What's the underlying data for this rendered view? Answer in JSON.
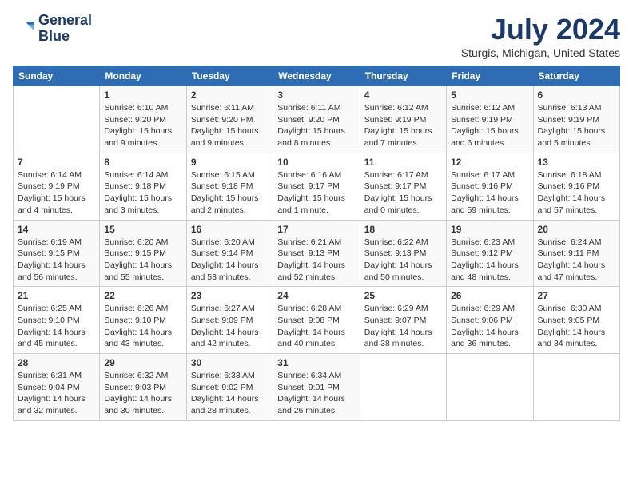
{
  "header": {
    "logo_line1": "General",
    "logo_line2": "Blue",
    "title": "July 2024",
    "subtitle": "Sturgis, Michigan, United States"
  },
  "weekdays": [
    "Sunday",
    "Monday",
    "Tuesday",
    "Wednesday",
    "Thursday",
    "Friday",
    "Saturday"
  ],
  "weeks": [
    [
      {
        "day": "",
        "info": ""
      },
      {
        "day": "1",
        "info": "Sunrise: 6:10 AM\nSunset: 9:20 PM\nDaylight: 15 hours\nand 9 minutes."
      },
      {
        "day": "2",
        "info": "Sunrise: 6:11 AM\nSunset: 9:20 PM\nDaylight: 15 hours\nand 9 minutes."
      },
      {
        "day": "3",
        "info": "Sunrise: 6:11 AM\nSunset: 9:20 PM\nDaylight: 15 hours\nand 8 minutes."
      },
      {
        "day": "4",
        "info": "Sunrise: 6:12 AM\nSunset: 9:19 PM\nDaylight: 15 hours\nand 7 minutes."
      },
      {
        "day": "5",
        "info": "Sunrise: 6:12 AM\nSunset: 9:19 PM\nDaylight: 15 hours\nand 6 minutes."
      },
      {
        "day": "6",
        "info": "Sunrise: 6:13 AM\nSunset: 9:19 PM\nDaylight: 15 hours\nand 5 minutes."
      }
    ],
    [
      {
        "day": "7",
        "info": "Sunrise: 6:14 AM\nSunset: 9:19 PM\nDaylight: 15 hours\nand 4 minutes."
      },
      {
        "day": "8",
        "info": "Sunrise: 6:14 AM\nSunset: 9:18 PM\nDaylight: 15 hours\nand 3 minutes."
      },
      {
        "day": "9",
        "info": "Sunrise: 6:15 AM\nSunset: 9:18 PM\nDaylight: 15 hours\nand 2 minutes."
      },
      {
        "day": "10",
        "info": "Sunrise: 6:16 AM\nSunset: 9:17 PM\nDaylight: 15 hours\nand 1 minute."
      },
      {
        "day": "11",
        "info": "Sunrise: 6:17 AM\nSunset: 9:17 PM\nDaylight: 15 hours\nand 0 minutes."
      },
      {
        "day": "12",
        "info": "Sunrise: 6:17 AM\nSunset: 9:16 PM\nDaylight: 14 hours\nand 59 minutes."
      },
      {
        "day": "13",
        "info": "Sunrise: 6:18 AM\nSunset: 9:16 PM\nDaylight: 14 hours\nand 57 minutes."
      }
    ],
    [
      {
        "day": "14",
        "info": "Sunrise: 6:19 AM\nSunset: 9:15 PM\nDaylight: 14 hours\nand 56 minutes."
      },
      {
        "day": "15",
        "info": "Sunrise: 6:20 AM\nSunset: 9:15 PM\nDaylight: 14 hours\nand 55 minutes."
      },
      {
        "day": "16",
        "info": "Sunrise: 6:20 AM\nSunset: 9:14 PM\nDaylight: 14 hours\nand 53 minutes."
      },
      {
        "day": "17",
        "info": "Sunrise: 6:21 AM\nSunset: 9:13 PM\nDaylight: 14 hours\nand 52 minutes."
      },
      {
        "day": "18",
        "info": "Sunrise: 6:22 AM\nSunset: 9:13 PM\nDaylight: 14 hours\nand 50 minutes."
      },
      {
        "day": "19",
        "info": "Sunrise: 6:23 AM\nSunset: 9:12 PM\nDaylight: 14 hours\nand 48 minutes."
      },
      {
        "day": "20",
        "info": "Sunrise: 6:24 AM\nSunset: 9:11 PM\nDaylight: 14 hours\nand 47 minutes."
      }
    ],
    [
      {
        "day": "21",
        "info": "Sunrise: 6:25 AM\nSunset: 9:10 PM\nDaylight: 14 hours\nand 45 minutes."
      },
      {
        "day": "22",
        "info": "Sunrise: 6:26 AM\nSunset: 9:10 PM\nDaylight: 14 hours\nand 43 minutes."
      },
      {
        "day": "23",
        "info": "Sunrise: 6:27 AM\nSunset: 9:09 PM\nDaylight: 14 hours\nand 42 minutes."
      },
      {
        "day": "24",
        "info": "Sunrise: 6:28 AM\nSunset: 9:08 PM\nDaylight: 14 hours\nand 40 minutes."
      },
      {
        "day": "25",
        "info": "Sunrise: 6:29 AM\nSunset: 9:07 PM\nDaylight: 14 hours\nand 38 minutes."
      },
      {
        "day": "26",
        "info": "Sunrise: 6:29 AM\nSunset: 9:06 PM\nDaylight: 14 hours\nand 36 minutes."
      },
      {
        "day": "27",
        "info": "Sunrise: 6:30 AM\nSunset: 9:05 PM\nDaylight: 14 hours\nand 34 minutes."
      }
    ],
    [
      {
        "day": "28",
        "info": "Sunrise: 6:31 AM\nSunset: 9:04 PM\nDaylight: 14 hours\nand 32 minutes."
      },
      {
        "day": "29",
        "info": "Sunrise: 6:32 AM\nSunset: 9:03 PM\nDaylight: 14 hours\nand 30 minutes."
      },
      {
        "day": "30",
        "info": "Sunrise: 6:33 AM\nSunset: 9:02 PM\nDaylight: 14 hours\nand 28 minutes."
      },
      {
        "day": "31",
        "info": "Sunrise: 6:34 AM\nSunset: 9:01 PM\nDaylight: 14 hours\nand 26 minutes."
      },
      {
        "day": "",
        "info": ""
      },
      {
        "day": "",
        "info": ""
      },
      {
        "day": "",
        "info": ""
      }
    ]
  ]
}
